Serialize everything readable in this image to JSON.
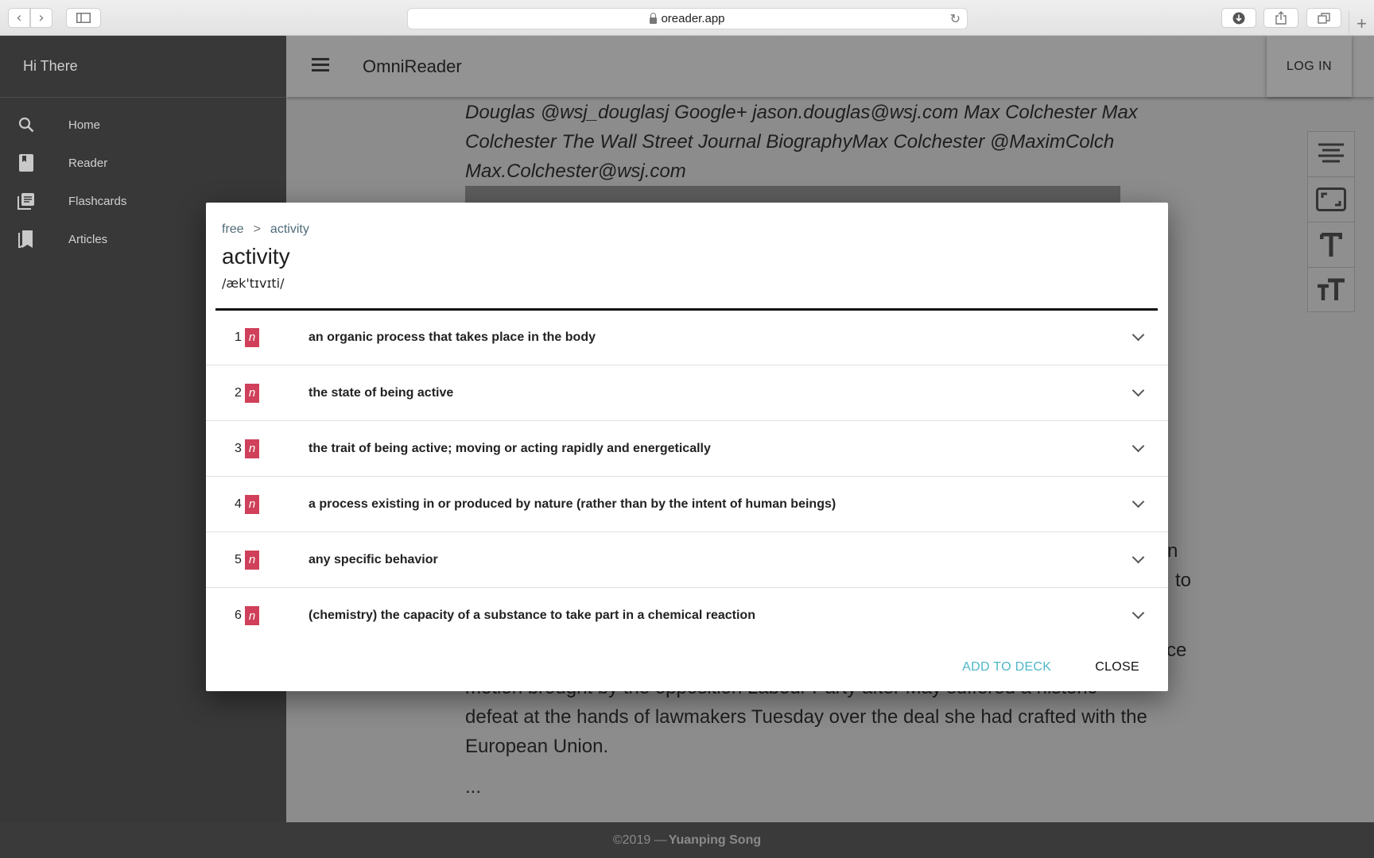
{
  "browser": {
    "url": "oreader.app",
    "back_glyph": "‹",
    "forward_glyph": "›",
    "reload_glyph": "↻",
    "new_tab_glyph": "+"
  },
  "sidebar": {
    "greeting": "Hi There",
    "items": [
      {
        "label": "Home",
        "icon": "search-icon"
      },
      {
        "label": "Reader",
        "icon": "book-icon"
      },
      {
        "label": "Flashcards",
        "icon": "library-icon"
      },
      {
        "label": "Articles",
        "icon": "bookmarks-icon"
      }
    ]
  },
  "topbar": {
    "title": "OmniReader",
    "login_label": "LOG IN"
  },
  "article": {
    "italic_lines": [
      "Douglas @wsj_douglasj Google+ jason.douglas@wsj.com Max Colchester Max",
      "Colchester The Wall Street Journal BiographyMax Colchester @MaximColch",
      "Max.Colchester@wsj.com"
    ],
    "side_fragments": [
      "n",
      "to",
      "ce"
    ],
    "body_lines": [
      "motion brought by the opposition Labour Party after May suffered a historic",
      "defeat at the hands of lawmakers Tuesday over the deal she had crafted with the",
      "European Union."
    ],
    "ellipsis": "..."
  },
  "tools": [
    "align-center-icon",
    "fit-screen-icon",
    "text-size-icon",
    "text-size-large-icon"
  ],
  "dialog": {
    "breadcrumb": {
      "first": "free",
      "separator": ">",
      "second": "activity"
    },
    "word": "activity",
    "ipa": "/æk'tɪvɪti/",
    "senses": [
      {
        "num": "1",
        "pos": "n",
        "definition": "an organic process that takes place in the body"
      },
      {
        "num": "2",
        "pos": "n",
        "definition": "the state of being active"
      },
      {
        "num": "3",
        "pos": "n",
        "definition": "the trait of being active; moving or acting rapidly and energetically"
      },
      {
        "num": "4",
        "pos": "n",
        "definition": "a process existing in or produced by nature (rather than by the intent of human beings)"
      },
      {
        "num": "5",
        "pos": "n",
        "definition": "any specific behavior"
      },
      {
        "num": "6",
        "pos": "n",
        "definition": "(chemistry) the capacity of a substance to take part in a chemical reaction"
      }
    ],
    "add_to_deck_label": "ADD TO DECK",
    "close_label": "CLOSE"
  },
  "footer": {
    "copyright": "©2019 —",
    "author": "Yuanping Song"
  },
  "colors": {
    "pos_badge": "#d0405a",
    "accent_button": "#4eb6c8",
    "sidebar_bg": "#383838"
  }
}
